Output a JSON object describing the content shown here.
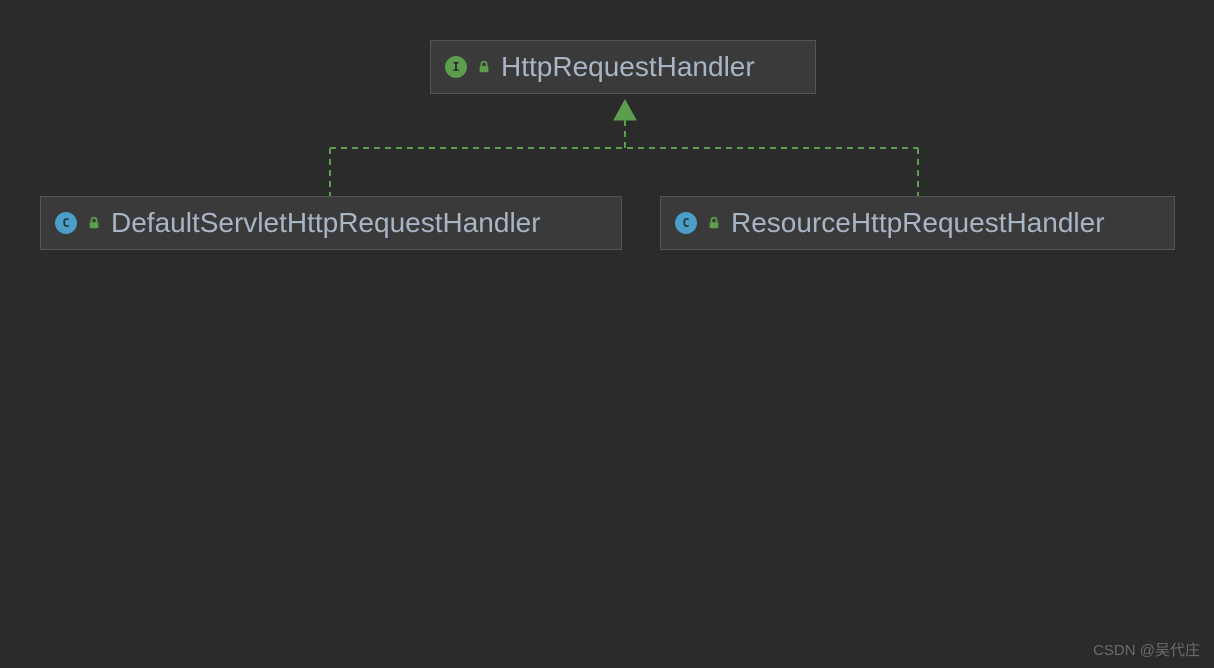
{
  "diagram": {
    "parent": {
      "type": "I",
      "name": "HttpRequestHandler"
    },
    "children": [
      {
        "type": "C",
        "name": "DefaultServletHttpRequestHandler"
      },
      {
        "type": "C",
        "name": "ResourceHttpRequestHandler"
      }
    ]
  },
  "watermark": "CSDN @吴代庄",
  "colors": {
    "background": "#2b2b2b",
    "boxBg": "#3a3a3a",
    "border": "#555555",
    "text": "#a8b5c4",
    "interfaceIcon": "#5b9e4d",
    "classIcon": "#4a9ec7",
    "connector": "#5b9e4d",
    "lock": "#5b9e4d"
  }
}
